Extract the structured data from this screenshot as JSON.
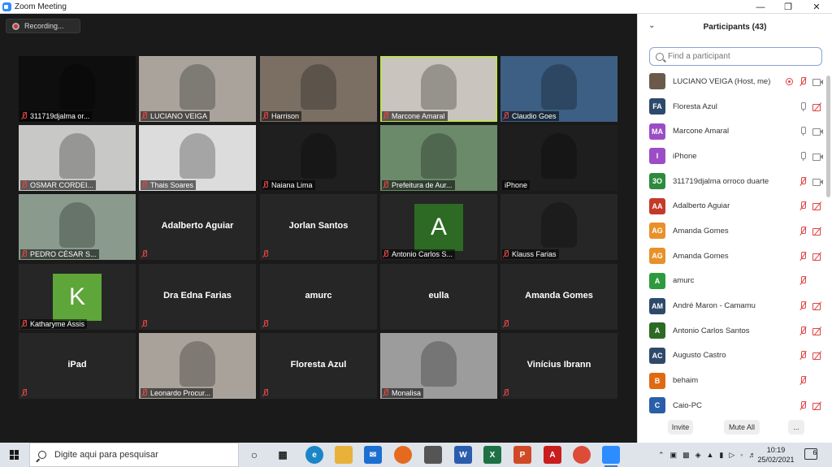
{
  "window": {
    "title": "Zoom Meeting"
  },
  "recording": {
    "label": "Recording..."
  },
  "tiles": [
    {
      "name": "311719djalma or...",
      "kind": "video",
      "bg": "#0e0e0e"
    },
    {
      "name": "LUCIANO VEIGA",
      "kind": "video",
      "bg": "#a9a39b"
    },
    {
      "name": "Harrison",
      "kind": "video",
      "bg": "#7b6f64"
    },
    {
      "name": "Marcone Amaral",
      "kind": "video",
      "bg": "#c9c4bd",
      "speaking": true
    },
    {
      "name": "Claudio Goes",
      "kind": "video",
      "bg": "#3d5f83"
    },
    {
      "name": "OSMAR CORDEI...",
      "kind": "video",
      "bg": "#c8c8c6"
    },
    {
      "name": "Thais Soares",
      "kind": "video",
      "bg": "#dcdcdc"
    },
    {
      "name": "Naiana Lima",
      "kind": "video",
      "bg": "#1f1f1f"
    },
    {
      "name": "Prefeitura de Aur...",
      "kind": "video",
      "bg": "#6b8a6a"
    },
    {
      "name": "iPhone",
      "kind": "video",
      "bg": "#1e1e1e",
      "plain": true
    },
    {
      "name": "PEDRO CÉSAR S...",
      "kind": "video",
      "bg": "#8a9b8e"
    },
    {
      "name": "Adalberto Aguiar",
      "kind": "name"
    },
    {
      "name": "Jorlan Santos",
      "kind": "name"
    },
    {
      "name": "Antonio Carlos S...",
      "kind": "avatar",
      "letter": "A",
      "color": "#2d6a24"
    },
    {
      "name": "Klauss Farias",
      "kind": "video",
      "bg": "#262626"
    },
    {
      "name": "Katharyme Assis",
      "kind": "avatar",
      "letter": "K",
      "color": "#5ea53a"
    },
    {
      "name": "Dra Edna Farias",
      "kind": "name"
    },
    {
      "name": "amurc",
      "kind": "name"
    },
    {
      "name": "eulla",
      "kind": "name",
      "nomic": true
    },
    {
      "name": "Amanda Gomes",
      "kind": "name"
    },
    {
      "name": "iPad",
      "kind": "name"
    },
    {
      "name": "Leonardo Procur...",
      "kind": "video",
      "bg": "#a8a29a"
    },
    {
      "name": "Floresta Azul",
      "kind": "name"
    },
    {
      "name": "Monalisa",
      "kind": "video",
      "bg": "#9c9c9c"
    },
    {
      "name": "Vinícius Ibrann",
      "kind": "name"
    }
  ],
  "panel": {
    "title": "Participants (43)",
    "search_placeholder": "Find a participant",
    "participants": [
      {
        "initials": "",
        "name": "LUCIANO VEIGA (Host, me)",
        "color": "#6b5a4a",
        "mic": "off",
        "video": "on",
        "rec": true,
        "photo": true
      },
      {
        "initials": "FA",
        "name": "Floresta Azul",
        "color": "#2e4a6b",
        "mic": "on",
        "video": "off"
      },
      {
        "initials": "MA",
        "name": "Marcone Amaral",
        "color": "#9b4dc6",
        "mic": "on",
        "video": "on"
      },
      {
        "initials": "I",
        "name": "iPhone",
        "color": "#9b4dc6",
        "mic": "on",
        "video": "on"
      },
      {
        "initials": "3O",
        "name": "311719djalma orroco duarte",
        "color": "#2e8b3e",
        "mic": "off",
        "video": "on"
      },
      {
        "initials": "AA",
        "name": "Adalberto Aguiar",
        "color": "#c43a2a",
        "mic": "off",
        "video": "off"
      },
      {
        "initials": "AG",
        "name": "Amanda Gomes",
        "color": "#e8912a",
        "mic": "off",
        "video": "off"
      },
      {
        "initials": "AG",
        "name": "Amanda Gomes",
        "color": "#e8912a",
        "mic": "off",
        "video": "off"
      },
      {
        "initials": "A",
        "name": "amurc",
        "color": "#2e9a3e",
        "mic": "off",
        "video": "none"
      },
      {
        "initials": "AM",
        "name": "André Maron - Camamu",
        "color": "#2e4a6b",
        "mic": "off",
        "video": "off"
      },
      {
        "initials": "A",
        "name": "Antonio Carlos Santos",
        "color": "#2d6a24",
        "mic": "off",
        "video": "off"
      },
      {
        "initials": "AC",
        "name": "Augusto Castro",
        "color": "#2e4a6b",
        "mic": "off",
        "video": "off"
      },
      {
        "initials": "B",
        "name": "behaim",
        "color": "#e06a12",
        "mic": "off",
        "video": "none"
      },
      {
        "initials": "C",
        "name": "Caio-PC",
        "color": "#2a5fa8",
        "mic": "off",
        "video": "off"
      }
    ],
    "invite_label": "Invite",
    "mute_all_label": "Mute All",
    "more_label": "..."
  },
  "taskbar": {
    "search_placeholder": "Digite aqui para pesquisar",
    "time": "10:19",
    "date": "25/02/2021",
    "notifications": "6"
  }
}
